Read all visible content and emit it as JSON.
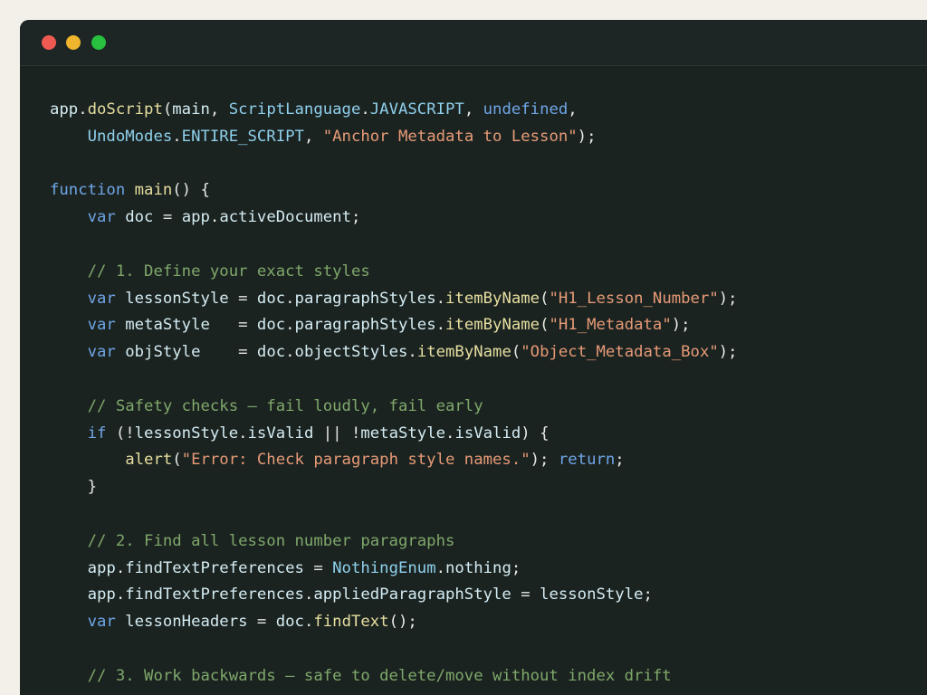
{
  "window": {
    "controls": [
      "close",
      "minimize",
      "maximize"
    ],
    "colors": {
      "close": "#ee5a52",
      "minimize": "#efb62d",
      "maximize": "#27c13f"
    }
  },
  "colors": {
    "background": "#1b2321",
    "keyword": "#6fa6e6",
    "function": "#e7dfa0",
    "type": "#8fd0ec",
    "string": "#e69a76",
    "comment": "#7fa86a",
    "identifier": "#d4ecf2",
    "plain": "#e6e8e4"
  },
  "code": {
    "lines": [
      [
        [
          "id",
          "app"
        ],
        [
          "p",
          "."
        ],
        [
          "fn",
          "doScript"
        ],
        [
          "p",
          "("
        ],
        [
          "id",
          "main"
        ],
        [
          "p",
          ", "
        ],
        [
          "cls",
          "ScriptLanguage"
        ],
        [
          "p",
          "."
        ],
        [
          "cls",
          "JAVASCRIPT"
        ],
        [
          "p",
          ", "
        ],
        [
          "kw",
          "undefined"
        ],
        [
          "p",
          ","
        ]
      ],
      [
        [
          "p",
          "    "
        ],
        [
          "cls",
          "UndoModes"
        ],
        [
          "p",
          "."
        ],
        [
          "cls",
          "ENTIRE_SCRIPT"
        ],
        [
          "p",
          ", "
        ],
        [
          "str",
          "\"Anchor Metadata to Lesson\""
        ],
        [
          "p",
          ");"
        ]
      ],
      [],
      [
        [
          "kw",
          "function"
        ],
        [
          "p",
          " "
        ],
        [
          "fn",
          "main"
        ],
        [
          "p",
          "() {"
        ]
      ],
      [
        [
          "p",
          "    "
        ],
        [
          "kw",
          "var"
        ],
        [
          "p",
          " "
        ],
        [
          "id",
          "doc"
        ],
        [
          "p",
          " = "
        ],
        [
          "id",
          "app"
        ],
        [
          "p",
          "."
        ],
        [
          "id",
          "activeDocument"
        ],
        [
          "p",
          ";"
        ]
      ],
      [],
      [
        [
          "p",
          "    "
        ],
        [
          "cm",
          "// 1. Define your exact styles"
        ]
      ],
      [
        [
          "p",
          "    "
        ],
        [
          "kw",
          "var"
        ],
        [
          "p",
          " "
        ],
        [
          "id",
          "lessonStyle"
        ],
        [
          "p",
          " = "
        ],
        [
          "id",
          "doc"
        ],
        [
          "p",
          "."
        ],
        [
          "id",
          "paragraphStyles"
        ],
        [
          "p",
          "."
        ],
        [
          "fn",
          "itemByName"
        ],
        [
          "p",
          "("
        ],
        [
          "str",
          "\"H1_Lesson_Number\""
        ],
        [
          "p",
          ");"
        ]
      ],
      [
        [
          "p",
          "    "
        ],
        [
          "kw",
          "var"
        ],
        [
          "p",
          " "
        ],
        [
          "id",
          "metaStyle"
        ],
        [
          "p",
          "   = "
        ],
        [
          "id",
          "doc"
        ],
        [
          "p",
          "."
        ],
        [
          "id",
          "paragraphStyles"
        ],
        [
          "p",
          "."
        ],
        [
          "fn",
          "itemByName"
        ],
        [
          "p",
          "("
        ],
        [
          "str",
          "\"H1_Metadata\""
        ],
        [
          "p",
          ");"
        ]
      ],
      [
        [
          "p",
          "    "
        ],
        [
          "kw",
          "var"
        ],
        [
          "p",
          " "
        ],
        [
          "id",
          "objStyle"
        ],
        [
          "p",
          "    = "
        ],
        [
          "id",
          "doc"
        ],
        [
          "p",
          "."
        ],
        [
          "id",
          "objectStyles"
        ],
        [
          "p",
          "."
        ],
        [
          "fn",
          "itemByName"
        ],
        [
          "p",
          "("
        ],
        [
          "str",
          "\"Object_Metadata_Box\""
        ],
        [
          "p",
          ");"
        ]
      ],
      [],
      [
        [
          "p",
          "    "
        ],
        [
          "cm",
          "// Safety checks — fail loudly, fail early"
        ]
      ],
      [
        [
          "p",
          "    "
        ],
        [
          "kw",
          "if"
        ],
        [
          "p",
          " (!"
        ],
        [
          "id",
          "lessonStyle"
        ],
        [
          "p",
          "."
        ],
        [
          "id",
          "isValid"
        ],
        [
          "p",
          " || !"
        ],
        [
          "id",
          "metaStyle"
        ],
        [
          "p",
          "."
        ],
        [
          "id",
          "isValid"
        ],
        [
          "p",
          ") {"
        ]
      ],
      [
        [
          "p",
          "        "
        ],
        [
          "fn",
          "alert"
        ],
        [
          "p",
          "("
        ],
        [
          "str",
          "\"Error: Check paragraph style names.\""
        ],
        [
          "p",
          "); "
        ],
        [
          "kw",
          "return"
        ],
        [
          "p",
          ";"
        ]
      ],
      [
        [
          "p",
          "    }"
        ]
      ],
      [],
      [
        [
          "p",
          "    "
        ],
        [
          "cm",
          "// 2. Find all lesson number paragraphs"
        ]
      ],
      [
        [
          "p",
          "    "
        ],
        [
          "id",
          "app"
        ],
        [
          "p",
          "."
        ],
        [
          "id",
          "findTextPreferences"
        ],
        [
          "p",
          " = "
        ],
        [
          "cls",
          "NothingEnum"
        ],
        [
          "p",
          "."
        ],
        [
          "id",
          "nothing"
        ],
        [
          "p",
          ";"
        ]
      ],
      [
        [
          "p",
          "    "
        ],
        [
          "id",
          "app"
        ],
        [
          "p",
          "."
        ],
        [
          "id",
          "findTextPreferences"
        ],
        [
          "p",
          "."
        ],
        [
          "id",
          "appliedParagraphStyle"
        ],
        [
          "p",
          " = "
        ],
        [
          "id",
          "lessonStyle"
        ],
        [
          "p",
          ";"
        ]
      ],
      [
        [
          "p",
          "    "
        ],
        [
          "kw",
          "var"
        ],
        [
          "p",
          " "
        ],
        [
          "id",
          "lessonHeaders"
        ],
        [
          "p",
          " = "
        ],
        [
          "id",
          "doc"
        ],
        [
          "p",
          "."
        ],
        [
          "fn",
          "findText"
        ],
        [
          "p",
          "();"
        ]
      ],
      [],
      [
        [
          "p",
          "    "
        ],
        [
          "cm",
          "// 3. Work backwards — safe to delete/move without index drift"
        ]
      ]
    ]
  }
}
